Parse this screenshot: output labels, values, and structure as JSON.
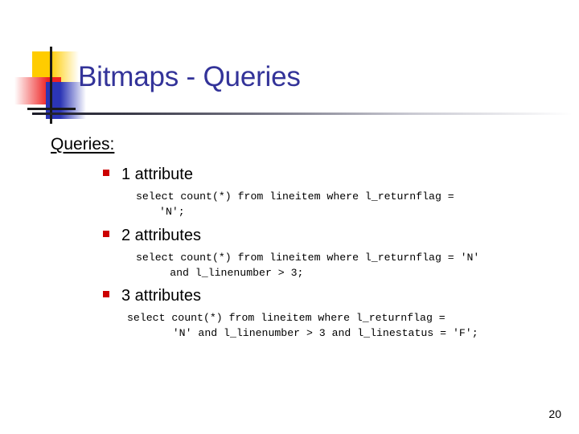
{
  "slide": {
    "title": "Bitmaps - Queries",
    "title_color": "#333399",
    "page_number": "20",
    "section_heading": "Queries:",
    "bullet_color": "#cc0000"
  },
  "logo": {
    "yellow": "#ffcc00",
    "red": "#ee2222",
    "blue": "#2b35b5",
    "cross": "#1a1a1a"
  },
  "items": [
    {
      "label": "1 attribute",
      "code_line1": "select count(*) from lineitem where l_returnflag =",
      "code_line2": "'N';"
    },
    {
      "label": "2 attributes",
      "code_line1": "select count(*) from lineitem where l_returnflag = 'N'",
      "code_line2": "and l_linenumber > 3;"
    },
    {
      "label": "3 attributes",
      "code_line1": "select count(*) from lineitem where l_returnflag =",
      "code_line2": "'N' and l_linenumber > 3 and l_linestatus = 'F';"
    }
  ]
}
